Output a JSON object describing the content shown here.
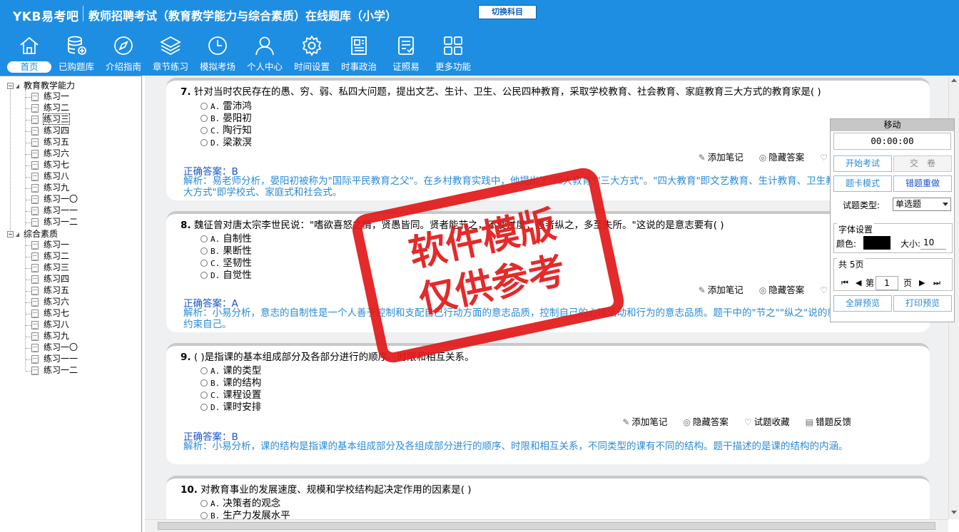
{
  "header": {
    "logo": "YKB易考吧",
    "title": "教师招聘考试（教育教学能力与综合素质）在线题库（小学）",
    "switch_button": "切换科目"
  },
  "nav": [
    {
      "label": "首页",
      "icon": "home-icon",
      "active": true
    },
    {
      "label": "已购题库",
      "icon": "database-add-icon"
    },
    {
      "label": "介绍指南",
      "icon": "compass-icon"
    },
    {
      "label": "章节练习",
      "icon": "layers-icon"
    },
    {
      "label": "模拟考场",
      "icon": "clock-icon"
    },
    {
      "label": "个人中心",
      "icon": "user-icon"
    },
    {
      "label": "时间设置",
      "icon": "gear-icon"
    },
    {
      "label": "时事政治",
      "icon": "newspaper-icon"
    },
    {
      "label": "证照易",
      "icon": "checklist-icon"
    },
    {
      "label": "更多功能",
      "icon": "grid-icon"
    }
  ],
  "tree": {
    "group1": {
      "label": "教育教学能力",
      "items": [
        "练习一",
        "练习二",
        "练习三",
        "练习四",
        "练习五",
        "练习六",
        "练习七",
        "练习八",
        "练习九",
        "练习一〇",
        "练习一一",
        "练习一二"
      ],
      "selected_index": 2
    },
    "group2": {
      "label": "综合素质",
      "items": [
        "练习一",
        "练习二",
        "练习三",
        "练习四",
        "练习五",
        "练习六",
        "练习七",
        "练习八",
        "练习九",
        "练习一〇",
        "练习一一",
        "练习一二"
      ]
    }
  },
  "actions": {
    "note": "添加笔记",
    "hide_answer": "隐藏答案",
    "favorite": "试题收藏",
    "feedback": "错题反馈"
  },
  "questions": [
    {
      "num": "7.",
      "stem": "针对当时农民存在的愚、穷、弱、私四大问题，提出文艺、生计、卫生、公民四种教育，采取学校教育、社会教育、家庭教育三大方式的教育家是( )",
      "options": [
        [
          "A.",
          "雷沛鸿"
        ],
        [
          "B.",
          "晏阳初"
        ],
        [
          "C.",
          "陶行知"
        ],
        [
          "D.",
          "梁漱溟"
        ]
      ],
      "answer": "正确答案：B",
      "analysis": "解析：易老师分析，晏阳初被称为\"国际平民教育之父\"。在乡村教育实践中，他提出了\"四大教育\"\"三大方式\"。\"四大教育\"即文艺教育、生计教育、卫生教育和公民教育；\"三大方式\"即学校式、家庭式和社会式。"
    },
    {
      "num": "8.",
      "stem": "魏征曾对唐太宗李世民说：\"嗜欲喜怒之情，贤愚皆同。贤者能节之，不使过度；愚者纵之，多至失所。\"这说的是意志要有( )",
      "options": [
        [
          "A.",
          "自制性"
        ],
        [
          "B.",
          "果断性"
        ],
        [
          "C.",
          "坚韧性"
        ],
        [
          "D.",
          "自觉性"
        ]
      ],
      "answer": "正确答案：A",
      "analysis": "解析：小易分析，意志的自制性是一个人善于控制和支配自己行动方面的意志品质，控制自己的心理活动和行为的意志品质。题干中的\"节之\"\"纵之\"说的就是善于控制自己、约束自己。"
    },
    {
      "num": "9.",
      "stem": "( )是指课的基本组成部分及各部分进行的顺序、时限和相互关系。",
      "options": [
        [
          "A.",
          "课的类型"
        ],
        [
          "B.",
          "课的结构"
        ],
        [
          "C.",
          "课程设置"
        ],
        [
          "D.",
          "课时安排"
        ]
      ],
      "answer": "正确答案：B",
      "analysis": "解析：小易分析，课的结构是指课的基本组成部分及各组成部分进行的顺序、时限和相互关系，不同类型的课有不同的结构。题干描述的是课的结构的内涵。"
    },
    {
      "num": "10.",
      "stem": "对教育事业的发展速度、规模和学校结构起决定作用的因素是( )",
      "options": [
        [
          "A.",
          "决策者的观念"
        ],
        [
          "B.",
          "生产力发展水平"
        ]
      ]
    }
  ],
  "panel": {
    "title": "移动",
    "timer": "00:00:00",
    "start_exam": "开始考试",
    "submit": "交　卷",
    "card_mode": "题卡模式",
    "redo_wrong": "错题重做",
    "type_label": "试题类型:",
    "type_value": "单选题",
    "font_group": "字体设置",
    "color_label": "颜色:",
    "font_color": "#000000",
    "size_label": "大小:",
    "size_value": "10",
    "total_pages": "共 5页",
    "page_prefix": "第",
    "page_value": "1",
    "page_suffix": "页",
    "fullscreen": "全屏预览",
    "print": "打印预览"
  },
  "watermark": {
    "line1": "软件模版",
    "line2": "仅供参考"
  },
  "colors": {
    "header_bg": "#1e8ee3",
    "answer": "#1a52c9",
    "analysis": "#2a8bd6",
    "stamp": "#e21a1a"
  }
}
